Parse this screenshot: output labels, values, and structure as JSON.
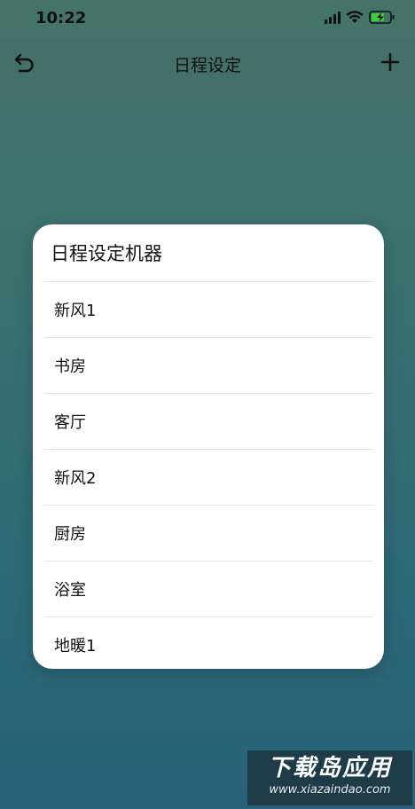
{
  "status_bar": {
    "time": "10:22"
  },
  "nav": {
    "title": "日程设定"
  },
  "dialog": {
    "title": "日程设定机器",
    "items": [
      {
        "label": "新风1"
      },
      {
        "label": "书房"
      },
      {
        "label": "客厅"
      },
      {
        "label": "新风2"
      },
      {
        "label": "厨房"
      },
      {
        "label": "浴室"
      },
      {
        "label": "地暖1"
      }
    ]
  },
  "watermark": {
    "main": "下载岛应用",
    "sub": "www.xiazaindao.com"
  },
  "colors": {
    "battery_charging": "#3ccf3c",
    "dialog_bg": "#ffffff"
  },
  "icons": {
    "back": "back-arrow-icon",
    "add": "plus-icon",
    "signal": "signal-icon",
    "wifi": "wifi-icon",
    "battery": "battery-charging-icon"
  }
}
